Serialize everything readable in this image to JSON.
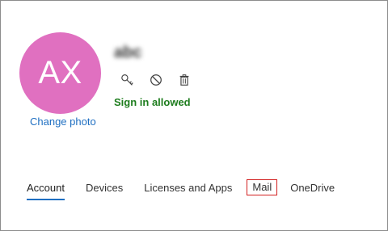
{
  "avatar": {
    "initials": "AX",
    "color": "#e070c0"
  },
  "change_photo_label": "Change photo",
  "user": {
    "name": "abc"
  },
  "actions": [
    {
      "name": "key-icon"
    },
    {
      "name": "block-icon"
    },
    {
      "name": "trash-icon"
    }
  ],
  "signin_status": "Sign in allowed",
  "tabs": [
    {
      "label": "Account",
      "active": true
    },
    {
      "label": "Devices"
    },
    {
      "label": "Licenses and Apps"
    },
    {
      "label": "Mail",
      "highlighted": true
    },
    {
      "label": "OneDrive"
    }
  ],
  "colors": {
    "accent": "#1f6fc2",
    "success": "#1e7d1e",
    "highlight_border": "#d21f1f"
  }
}
